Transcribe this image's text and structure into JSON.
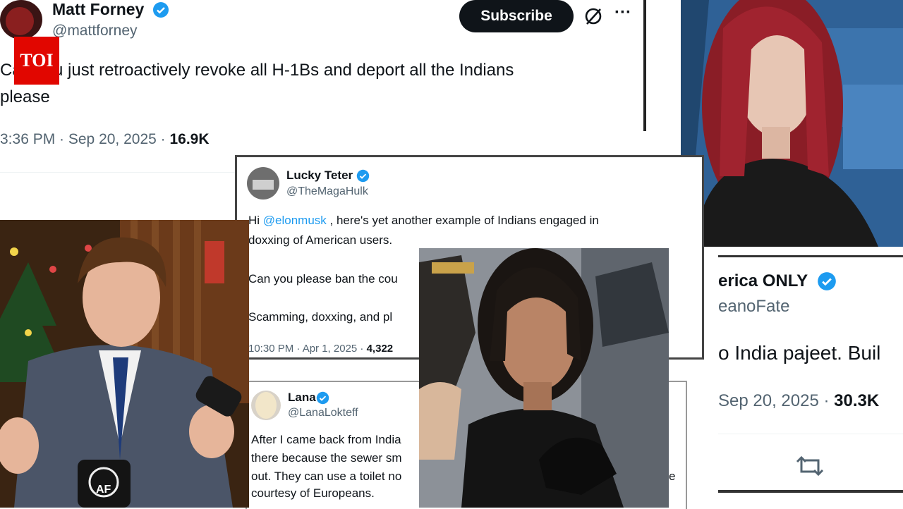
{
  "badge": {
    "label": "TOI",
    "color": "#e10600"
  },
  "tweet_forney": {
    "name": "Matt Forney",
    "handle": "@mattforney",
    "subscribe_label": "Subscribe",
    "more_label": "···",
    "text_line1": "Can you just retroactively revoke all H-1Bs and deport all the Indians",
    "text_line2": "please",
    "meta_time": "3:36 PM · Sep 20, 2025 · ",
    "meta_views": "16.9K"
  },
  "tweet_teter": {
    "name": "Lucky Teter",
    "handle": "@TheMagaHulk",
    "line1_prefix": "Hi ",
    "line1_mention": "@elonmusk",
    "line1_suffix": " , here's yet another example of Indians engaged in",
    "line2": "doxxing of American users.",
    "line3": "Can you please ban the cou",
    "line4": "Scamming, doxxing, and pl",
    "meta_time": "10:30 PM · Apr 1, 2025 · ",
    "meta_views": "4,322"
  },
  "tweet_lana": {
    "name": "Lana",
    "handle": "@LanaLokteff",
    "line1": "After I came back from India",
    "line2": "there because the sewer sm",
    "line3": "out. They can use a toilet no",
    "line4": "courtesy of Europeans.",
    "trailing": "e"
  },
  "tweet_america": {
    "name": "erica ONLY",
    "handle": "eanoFate",
    "text": "o India pajeet. Buil",
    "meta_time": "Sep 20, 2025 · ",
    "meta_views": "30.3K"
  },
  "photo_host": {
    "mic_logo": "AF"
  },
  "colors": {
    "verified": "#1d9bf0",
    "mention": "#1d9bf0",
    "text": "#0f1419",
    "muted": "#536471"
  },
  "icons": [
    "verified-badge-icon",
    "grok-icon",
    "more-icon",
    "retweet-icon"
  ]
}
